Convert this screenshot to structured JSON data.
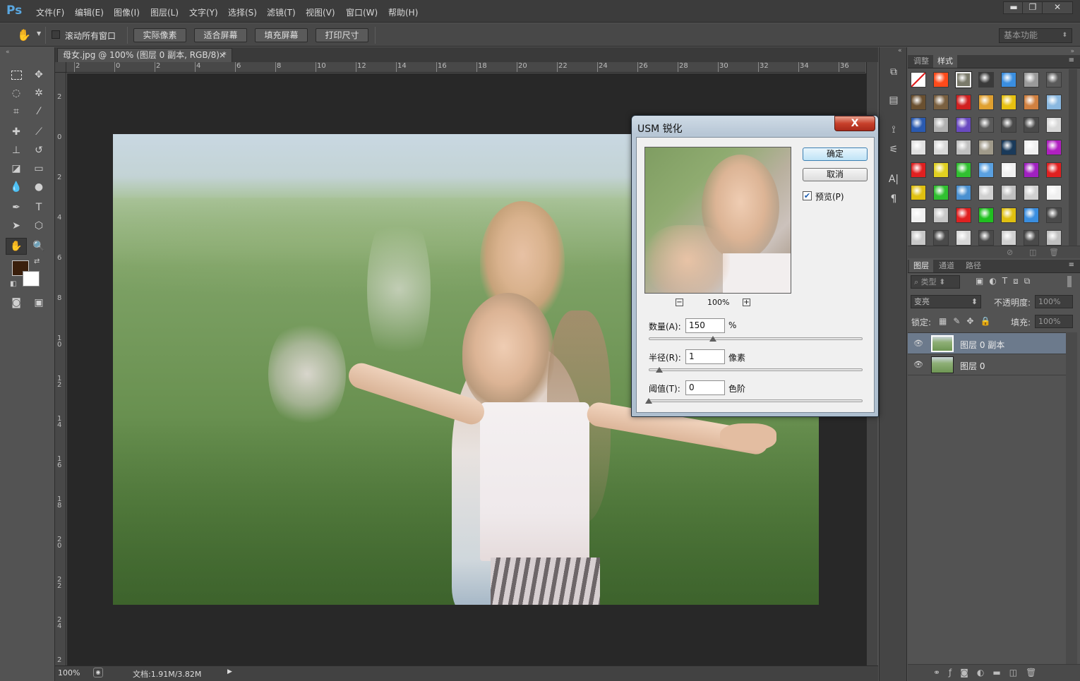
{
  "app": {
    "logo": "Ps",
    "menu": [
      "文件(F)",
      "编辑(E)",
      "图像(I)",
      "图层(L)",
      "文字(Y)",
      "选择(S)",
      "滤镜(T)",
      "视图(V)",
      "窗口(W)",
      "帮助(H)"
    ],
    "window_buttons": {
      "minimize": "▬",
      "restore": "❐",
      "close": "✕"
    }
  },
  "options": {
    "scroll_all_label": "滚动所有窗口",
    "buttons": [
      "实际像素",
      "适合屏幕",
      "填充屏幕",
      "打印尺寸"
    ],
    "workspace": "基本功能"
  },
  "document": {
    "tab_title": "母女.jpg @ 100% (图层 0 副本, RGB/8) *",
    "tab_close": "×",
    "ruler_h_labels": [
      "2",
      "0",
      "2",
      "4",
      "6",
      "8",
      "10",
      "12",
      "14",
      "16",
      "18",
      "20",
      "22",
      "24",
      "26",
      "28",
      "30",
      "32",
      "34",
      "36"
    ],
    "ruler_v_labels": [
      "2",
      "0",
      "2",
      "4",
      "6",
      "8",
      "1 0",
      "1 2",
      "1 4",
      "1 6",
      "1 8",
      "2 0",
      "2 2",
      "2 4",
      "2"
    ],
    "status_zoom": "100%",
    "status_doc": "文档:1.91M/3.82M",
    "foreground_color": "#3a1f0c",
    "background_color": "#ffffff"
  },
  "usm_dialog": {
    "title": "USM 锐化",
    "close": "X",
    "ok_label": "确定",
    "cancel_label": "取消",
    "preview_label": "预览(P)",
    "preview_checked": true,
    "zoom_minus": "−",
    "zoom_value": "100%",
    "zoom_plus": "+",
    "amount_label": "数量(A):",
    "amount_value": "150",
    "amount_unit": "%",
    "amount_fraction": 0.3,
    "radius_label": "半径(R):",
    "radius_value": "1",
    "radius_unit": "像素",
    "radius_fraction": 0.05,
    "threshold_label": "阈值(T):",
    "threshold_value": "0",
    "threshold_unit": "色阶",
    "threshold_fraction": 0.0
  },
  "panels": {
    "top_tabs": [
      "调整",
      "样式"
    ],
    "layer_tabs": [
      "图层",
      "通道",
      "路径"
    ],
    "kind_filter": "类型",
    "blend_mode": "变亮",
    "opacity_label": "不透明度:",
    "opacity_value": "100%",
    "lock_label": "锁定:",
    "fill_label": "填充:",
    "fill_value": "100%",
    "layers": [
      {
        "name": "图层 0 副本",
        "selected": true
      },
      {
        "name": "图层 0",
        "selected": false
      }
    ]
  },
  "styles": [
    [
      "#ffffff",
      "#ff4a1a",
      "#7a7a6a",
      "#3a3a3a",
      "#3a8ee0",
      "#9a9a9a",
      "#5a5a5a"
    ],
    [
      "#6a5030",
      "#7a6040",
      "#d02020",
      "#e0a030",
      "#e6c010",
      "#d08040",
      "#8ab8e0"
    ],
    [
      "#2a5ab0",
      "#b0b0b0",
      "#6a4ac0",
      "#5a5a5a",
      "#4a4a4a",
      "#4a4a4a",
      "#d8d8d8"
    ],
    [
      "#e0e0e0",
      "#d8d8d8",
      "#c0c0c0",
      "#a09a8a",
      "#1a3a5a",
      "#f0f0f0",
      "#b020c0"
    ],
    [
      "#e02020",
      "#e0d020",
      "#30c030",
      "#5aa0e0",
      "#f0f0f0",
      "#a020c0",
      "#e02020"
    ],
    [
      "#e0c010",
      "#30c030",
      "#4a90d0",
      "#d0d0d0",
      "#c0c0c0",
      "#d0d0d0",
      "#f0f0f0"
    ],
    [
      "#f0f0f0",
      "#c8c8c8",
      "#e02020",
      "#20c020",
      "#e0c010",
      "#3a8ee0",
      "#4a4a4a"
    ],
    [
      "#c8c8c8",
      "#4a4a4a",
      "#d8d8d8",
      "#4a4a4a",
      "#d0d0d0",
      "#4a4a4a",
      "#c0c0c0"
    ]
  ]
}
